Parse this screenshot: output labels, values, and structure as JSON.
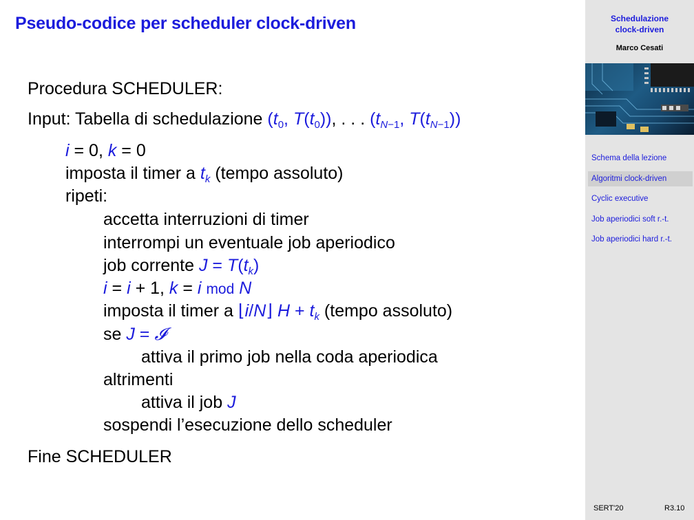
{
  "slide": {
    "title": "Pseudo-codice per scheduler clock-driven",
    "procedure_header": "Procedura SCHEDULER:",
    "input_label": "Input: Tabella di schedulazione",
    "input_formula": "(t0, T(t0)), . . . (tN−1, T(tN−1))",
    "end_label": "Fine SCHEDULER",
    "lines": {
      "init": "i = 0, k = 0",
      "set_timer_pre": "imposta il timer a",
      "set_timer_post": "(tempo assoluto)",
      "repeat": "ripeti:",
      "accept": "accetta interruzioni di timer",
      "interrupt": "interrompi un eventuale job aperiodico",
      "current_job_pre": "job corrente",
      "increment": "i = i + 1, k = i mod N",
      "set_timer2_pre": "imposta il timer a",
      "set_timer2_post": "(tempo assoluto)",
      "if_pre": "se",
      "activate_first": "attiva il primo job nella coda aperiodica",
      "else": "altrimenti",
      "activate_job_pre": "attiva il job",
      "suspend": "sospendi l’esecuzione dello scheduler"
    }
  },
  "sidebar": {
    "title_line1": "Schedulazione",
    "title_line2": "clock-driven",
    "author": "Marco Cesati",
    "nav": [
      {
        "label": "Schema della lezione"
      },
      {
        "label": "Algoritmi clock-driven"
      },
      {
        "label": "Cyclic executive"
      },
      {
        "label": "Job aperiodici soft r.-t."
      },
      {
        "label": "Job aperiodici hard r.-t."
      }
    ],
    "footer_left": "SERT'20",
    "footer_right": "R3.10"
  },
  "colors": {
    "accent": "#1c1cdc",
    "sidebar_bg": "#e4e4e4",
    "active_nav_bg": "#d0d0d0"
  }
}
